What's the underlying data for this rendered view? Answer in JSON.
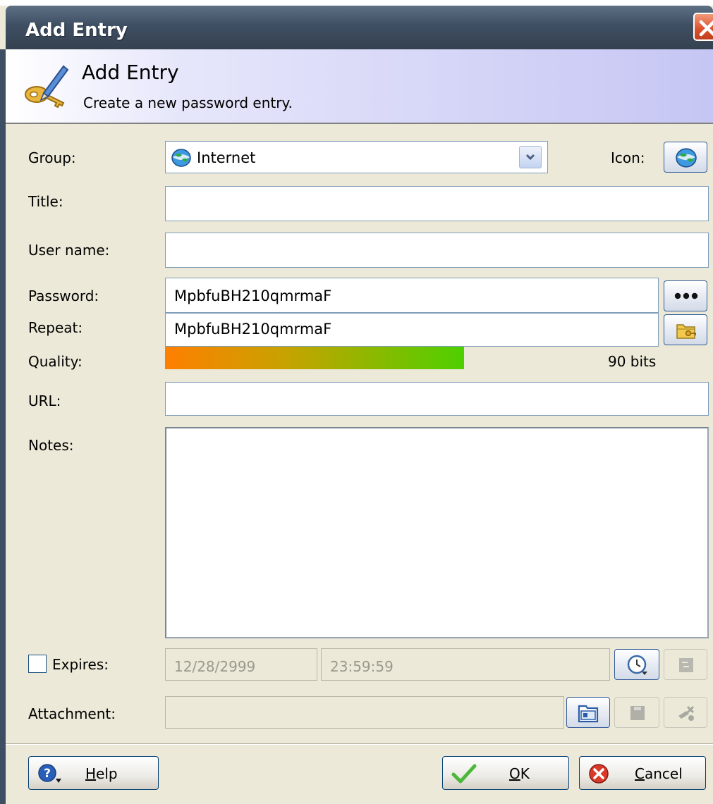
{
  "window": {
    "title": "Add Entry"
  },
  "banner": {
    "title": "Add Entry",
    "description": "Create a new password entry."
  },
  "form": {
    "group_label": "Group:",
    "group_value": "Internet",
    "icon_label": "Icon:",
    "title_label": "Title:",
    "title_value": "",
    "username_label": "User name:",
    "username_value": "",
    "password_label": "Password:",
    "password_value": "MpbfuBH210qmrmaF",
    "repeat_label": "Repeat:",
    "repeat_value": "MpbfuBH210qmrmaF",
    "quality_label": "Quality:",
    "quality_text": "90 bits",
    "quality_fraction": 0.55,
    "url_label": "URL:",
    "url_value": "",
    "notes_label": "Notes:",
    "notes_value": "",
    "expires_label": "Expires:",
    "expires_checked": false,
    "expires_date": "12/28/2999",
    "expires_time": "23:59:59",
    "attachment_label": "Attachment:",
    "attachment_value": ""
  },
  "buttons": {
    "help_pre": "",
    "help_u": "H",
    "help_post": "elp",
    "ok_u": "O",
    "ok_post": "K",
    "cancel_u": "C",
    "cancel_post": "ancel"
  },
  "icons": {
    "titlebar_close": "close-icon",
    "banner": "key-pencil-icon",
    "group": "globe-icon",
    "password_toggle": "dots-icon",
    "password_generator": "folder-key-icon",
    "expires_picker": "clock-icon",
    "expires_extra": "calendar-icon",
    "attachment_open": "open-file-icon",
    "attachment_save": "save-icon",
    "attachment_remove": "remove-attachment-icon",
    "help": "help-icon",
    "ok": "check-icon",
    "cancel": "cancel-icon"
  },
  "colors": {
    "titlebar": "#3f4f63",
    "quality_start": "#ff7f00",
    "quality_end": "#4ed000",
    "close_button": "#d9502c"
  }
}
